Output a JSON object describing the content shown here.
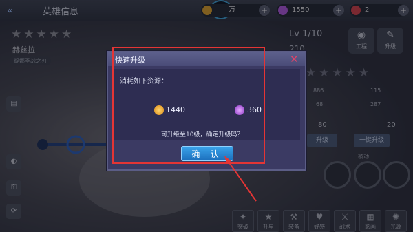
{
  "topbar": {
    "title": "英雄信息",
    "gold": "万",
    "gems": "1550",
    "tickets": "2",
    "logo": "BA"
  },
  "hero": {
    "stars": "★★★★★",
    "name": "赫丝拉",
    "subtitle": "缇娜圣战之刃"
  },
  "right_panel": {
    "level_prefix": "Lv",
    "level": "1/10",
    "power": "210",
    "buttons": [
      "工程",
      "升级"
    ],
    "stars": "★★★★★",
    "stats": [
      "886",
      "115",
      "68",
      "287"
    ],
    "costs": [
      "80",
      "20"
    ],
    "upgrade_btn": "升级",
    "upgrade_all_btn": "一键升级",
    "skill_label": "被动"
  },
  "bottom_tabs": [
    "突破",
    "升星",
    "装备",
    "好感",
    "战术",
    "影画",
    "光源"
  ],
  "dialog": {
    "title": "快速升级",
    "message": "消耗如下资源：",
    "gold_cost": "1440",
    "gem_cost": "360",
    "question": "可升级至10级，确定升级吗？",
    "confirm_label": "确 认",
    "close_icon": "close-x-icon"
  },
  "colors": {
    "highlight": "#e43535",
    "confirm": "#2a89d8",
    "dialog_bg": "#3b3a63"
  }
}
